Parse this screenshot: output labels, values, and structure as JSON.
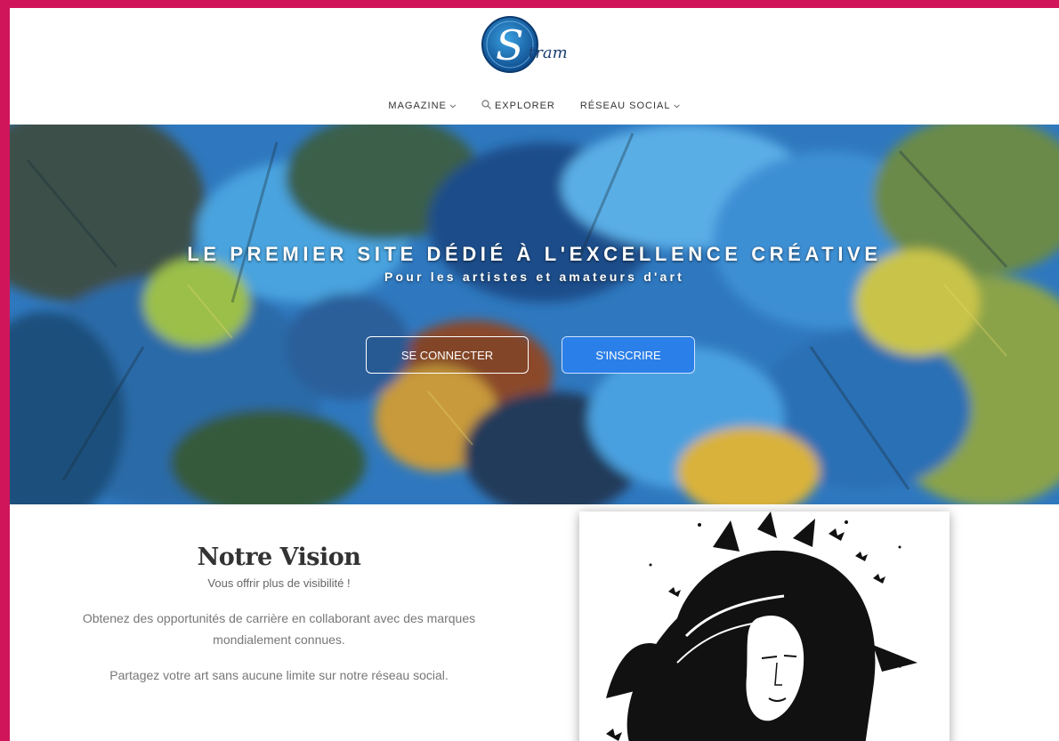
{
  "brand": {
    "logo_text": "tram",
    "logo_letter": "S"
  },
  "nav": [
    {
      "label": "MAGAZINE",
      "icon": "chevron-down-icon"
    },
    {
      "label": "EXPLORER",
      "icon": "search-icon"
    },
    {
      "label": "RÉSEAU SOCIAL",
      "icon": "chevron-down-icon"
    }
  ],
  "hero": {
    "title": "LE PREMIER SITE DÉDIÉ À L'EXCELLENCE CRÉATIVE",
    "subtitle": "Pour les artistes et amateurs d'art",
    "login_label": "SE CONNECTER",
    "signup_label": "S'INSCRIRE"
  },
  "vision": {
    "heading": "Notre Vision",
    "tagline": "Vous offrir plus de visibilité !",
    "paragraphs": [
      "Obtenez des opportunités de carrière en collaborant avec des marques mondialement connues.",
      "Partagez votre art sans aucune limite sur notre réseau social."
    ]
  },
  "colors": {
    "frame": "#d0155b",
    "accent_button": "#2b7fe8",
    "logo_blue": "#1a5fa0"
  }
}
